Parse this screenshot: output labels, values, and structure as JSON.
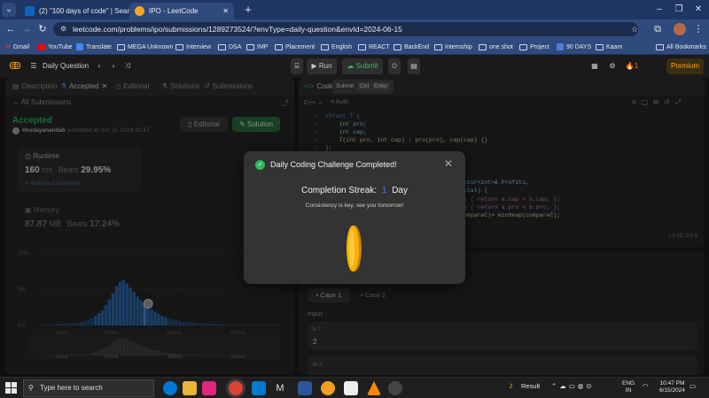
{
  "browser": {
    "tabs": [
      {
        "label": "(2) \"100 days of code\" | Search",
        "icon": "linkedin-icon"
      },
      {
        "label": "IPO - LeetCode",
        "icon": "leetcode-icon"
      }
    ],
    "url": "leetcode.com/problems/ipo/submissions/1289273524/?envType=daily-question&envId=2024-06-15",
    "bookmarks": [
      "Gmail",
      "YouTube",
      "Translate",
      "MEGA Unknown",
      "Interview",
      "DSA",
      "IMP",
      "Placement",
      "English",
      "REACT",
      "BackEnd",
      "Internship",
      "one shot",
      "Project",
      "90 DAYS",
      "Kaam"
    ],
    "all_bookmarks": "All Bookmarks"
  },
  "lc_header": {
    "daily_question": "Daily Question",
    "run": "Run",
    "submit": "Submit",
    "streak_count": "1",
    "premium": "Premium"
  },
  "left_panel": {
    "tabs": [
      "Description",
      "Accepted",
      "Editorial",
      "Solutions",
      "Submissions"
    ],
    "all_submissions": "All Submissions",
    "status": "Accepted",
    "user": "Hrudayananda5",
    "submitted_at": "submitted at Jun 15, 2024 22:47",
    "editorial_btn": "Editorial",
    "solution_btn": "Solution",
    "runtime_label": "Runtime",
    "runtime_value": "160",
    "runtime_unit": "ms",
    "beats_label": "Beats",
    "runtime_beats": "29.95%",
    "analyze": "Analyze Complexity",
    "memory_label": "Memory",
    "memory_value": "87.87",
    "memory_unit": "MB",
    "memory_beats": "17.24%",
    "y_ticks": [
      "10%",
      "5%",
      "0%"
    ],
    "x_ticks": [
      "62ms",
      "125ms",
      "188ms",
      "250ms"
    ],
    "x_ticks_mini": [
      "62ms",
      "125ms",
      "188ms",
      "250ms"
    ]
  },
  "editor": {
    "title": "Code",
    "tooltip": {
      "label": "Submit",
      "key1": "Ctrl",
      "key2": "Enter"
    },
    "language": "C++",
    "auto": "Auto",
    "lines": [
      {
        "n": "1",
        "code": "struct T {"
      },
      {
        "n": "2",
        "code": "    int pro;"
      },
      {
        "n": "3",
        "code": "    int cap;"
      },
      {
        "n": "4",
        "code": "    T(int pro, int cap) : pro(pro), cap(cap) {}"
      },
      {
        "n": "5",
        "code": "};"
      }
    ],
    "frag1": "ector<int>& Profits,",
    "frag2": "pital) {",
    "frag3": "b) { return a.cap > b.cap; };",
    "frag4": "b) { return a.pro < b.pro; };",
    "frag5": "compareC)> minHeap(compareC);",
    "cursor_pos": "Ln 29, Col 6"
  },
  "testcase": {
    "case1": "Case 1",
    "case2": "Case 2",
    "input_label": "Input",
    "k_label": "k =",
    "k_value": "2",
    "w_label": "w ="
  },
  "modal": {
    "title": "Daily Coding Challenge Completed!",
    "streak_label": "Completion Streak:",
    "streak_value": "1",
    "streak_unit": "Day",
    "message": "Consistency is key, see you tomorrow!"
  },
  "taskbar": {
    "search_placeholder": "Type here to search",
    "result": "Result",
    "lang_top": "ENG",
    "lang_bottom": "IN",
    "time": "10:47 PM",
    "date": "6/15/2024"
  },
  "colors": {
    "accent_green": "#2cbb5d",
    "leetcode_orange": "#ffa116",
    "chart_blue": "#2b6cb0",
    "streak_blue": "#3b82f6"
  },
  "chart_data": {
    "type": "bar",
    "title": "",
    "xlabel": "",
    "ylabel": "",
    "ylim": [
      0,
      10
    ],
    "x_tick_labels": [
      "62ms",
      "125ms",
      "188ms",
      "250ms"
    ],
    "y_tick_labels": [
      "10%",
      "5%",
      "0%"
    ],
    "values": [
      0.1,
      0.1,
      0.1,
      0.1,
      0.2,
      0.2,
      0.2,
      0.3,
      0.3,
      0.3,
      0.4,
      0.5,
      0.6,
      0.8,
      1.0,
      1.3,
      1.7,
      2.1,
      2.8,
      3.6,
      4.5,
      5.4,
      6.0,
      6.3,
      5.8,
      5.2,
      4.6,
      4.0,
      3.5,
      3.0,
      2.6,
      2.2,
      1.9,
      1.6,
      1.3,
      1.1,
      0.9,
      0.8,
      0.7,
      0.6,
      0.5,
      0.5,
      0.4,
      0.4,
      0.3,
      0.3,
      0.3,
      0.2,
      0.2,
      0.2,
      0.2,
      0.2,
      0.1,
      0.1,
      0.1,
      0.1,
      0.1,
      0.1,
      0.1,
      0.1,
      0.1,
      0.1,
      0.1,
      0.1,
      0.1,
      0.1,
      0.1,
      0.1
    ],
    "highlight_index": 29,
    "grid": true
  }
}
